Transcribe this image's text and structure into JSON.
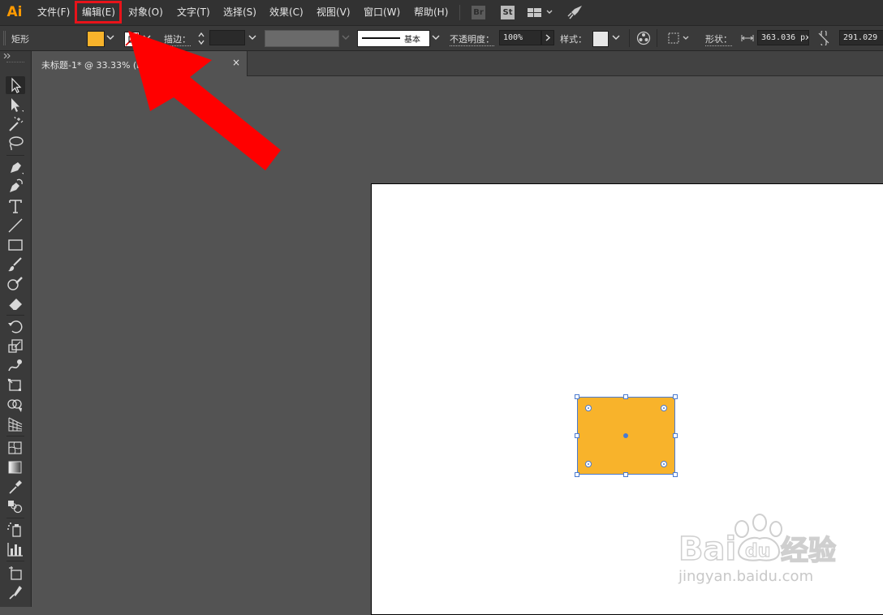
{
  "app": {
    "logo": "Ai"
  },
  "menu": [
    {
      "label": "文件(F)"
    },
    {
      "label": "编辑(E)",
      "highlighted": true
    },
    {
      "label": "对象(O)"
    },
    {
      "label": "文字(T)"
    },
    {
      "label": "选择(S)"
    },
    {
      "label": "效果(C)"
    },
    {
      "label": "视图(V)"
    },
    {
      "label": "窗口(W)"
    },
    {
      "label": "帮助(H)"
    }
  ],
  "app_badges": {
    "bridge": "Br",
    "stock": "St"
  },
  "control": {
    "object_type": "矩形",
    "fill_color": "#f8b32b",
    "stroke_label": "描边：",
    "stroke_profile": "基本",
    "opacity_label": "不透明度：",
    "opacity_value": "100%",
    "style_label": "样式：",
    "shape_label": "形状：",
    "width_value": "363.036 px",
    "height_value": "291.029 px"
  },
  "document_tab": {
    "title": "未标题-1* @ 33.33% (RGB/GPU 预览)",
    "close_glyph": "×"
  },
  "tools": [
    "selection-tool",
    "direct-selection-tool",
    "magic-wand-tool",
    "lasso-tool",
    "pen-tool",
    "curvature-tool",
    "type-tool",
    "line-segment-tool",
    "rectangle-tool",
    "paintbrush-tool",
    "shaper-tool",
    "eraser-tool",
    "rotate-tool",
    "scale-tool",
    "warp-tool",
    "free-transform-tool",
    "shape-builder-tool",
    "perspective-grid-tool",
    "mesh-tool",
    "gradient-tool",
    "eyedropper-tool",
    "blend-tool",
    "symbol-sprayer-tool",
    "column-graph-tool",
    "artboard-tool",
    "slice-tool"
  ],
  "canvas": {
    "shape_fill": "#f8b32b",
    "selection_color": "#4a7ad0"
  },
  "annotation": {
    "arrow_color": "#ff0000",
    "highlight_color": "#e8131a"
  },
  "watermark": {
    "brand": "Baidu经验",
    "url": "jingyan.baidu.com"
  }
}
